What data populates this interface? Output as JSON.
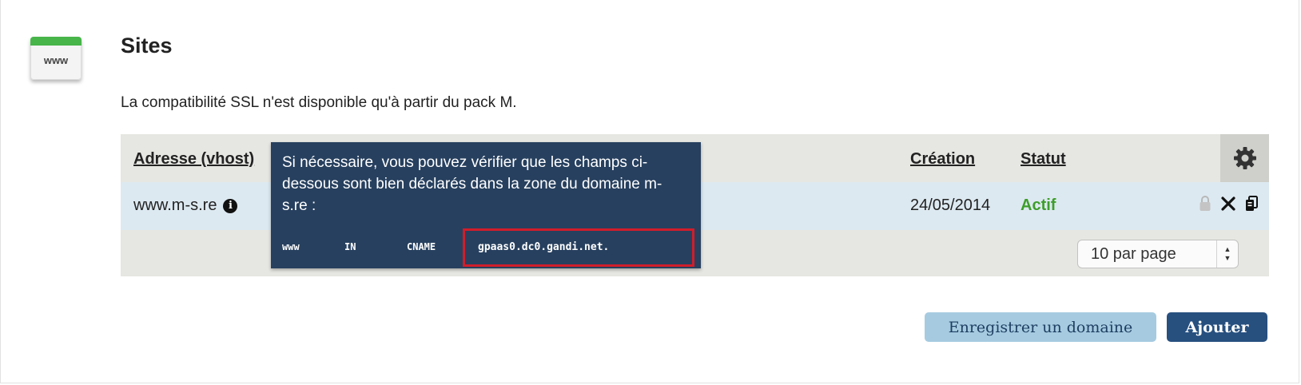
{
  "header": {
    "icon": {
      "name": "www-icon",
      "label": "www",
      "accent": "#47b54a"
    },
    "title": "Sites"
  },
  "notice": "La compatibilité SSL n'est disponible qu'à partir du pack M.",
  "table": {
    "columns": {
      "address": "Adresse (vhost)",
      "created": "Création",
      "status": "Statut"
    },
    "settings_icon": "gear-icon",
    "rows": [
      {
        "address": "www.m-s.re",
        "info_icon": "info-icon",
        "created": "24/05/2014",
        "status": "Actif",
        "status_color": "#3e9e2a"
      }
    ],
    "row_action_icons": [
      "lock-icon",
      "delete-icon",
      "copy-icon"
    ],
    "pagination": {
      "selected": "10 par page"
    }
  },
  "tooltip": {
    "message": "Si nécessaire, vous pouvez vérifier que les champs ci-dessous sont bien déclarés dans la zone du domaine m-s.re :",
    "dns_record": {
      "name": "www",
      "class": "IN",
      "type": "CNAME",
      "value": "gpaas0.dc0.gandi.net."
    },
    "highlight_color": "#d11d2a",
    "background": "#27405f"
  },
  "buttons": {
    "register_domain": "Enregistrer un domaine",
    "add": "Ajouter"
  }
}
